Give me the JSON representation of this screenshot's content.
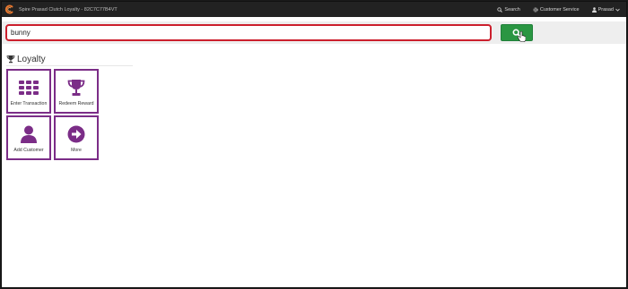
{
  "navbar": {
    "title": "Spire Prasad Clutch Loyalty - 82C7C77B4VT",
    "search_label": "Search",
    "customer_service_label": "Customer Service",
    "user_label": "Prasad"
  },
  "search": {
    "value": "bunny"
  },
  "loyalty": {
    "title": "Loyalty",
    "tiles": [
      {
        "label": "Enter Transaction",
        "icon": "grid-icon"
      },
      {
        "label": "Redeem Reward",
        "icon": "trophy-icon"
      },
      {
        "label": "Add Customer",
        "icon": "user-icon"
      },
      {
        "label": "More",
        "icon": "arrow-circle-icon"
      }
    ]
  },
  "colors": {
    "navbar": "#222222",
    "tile_accent": "#7b2d87",
    "search_border": "#cc1f2d",
    "search_button": "#2a9642",
    "brand_orange": "#e8772e"
  }
}
